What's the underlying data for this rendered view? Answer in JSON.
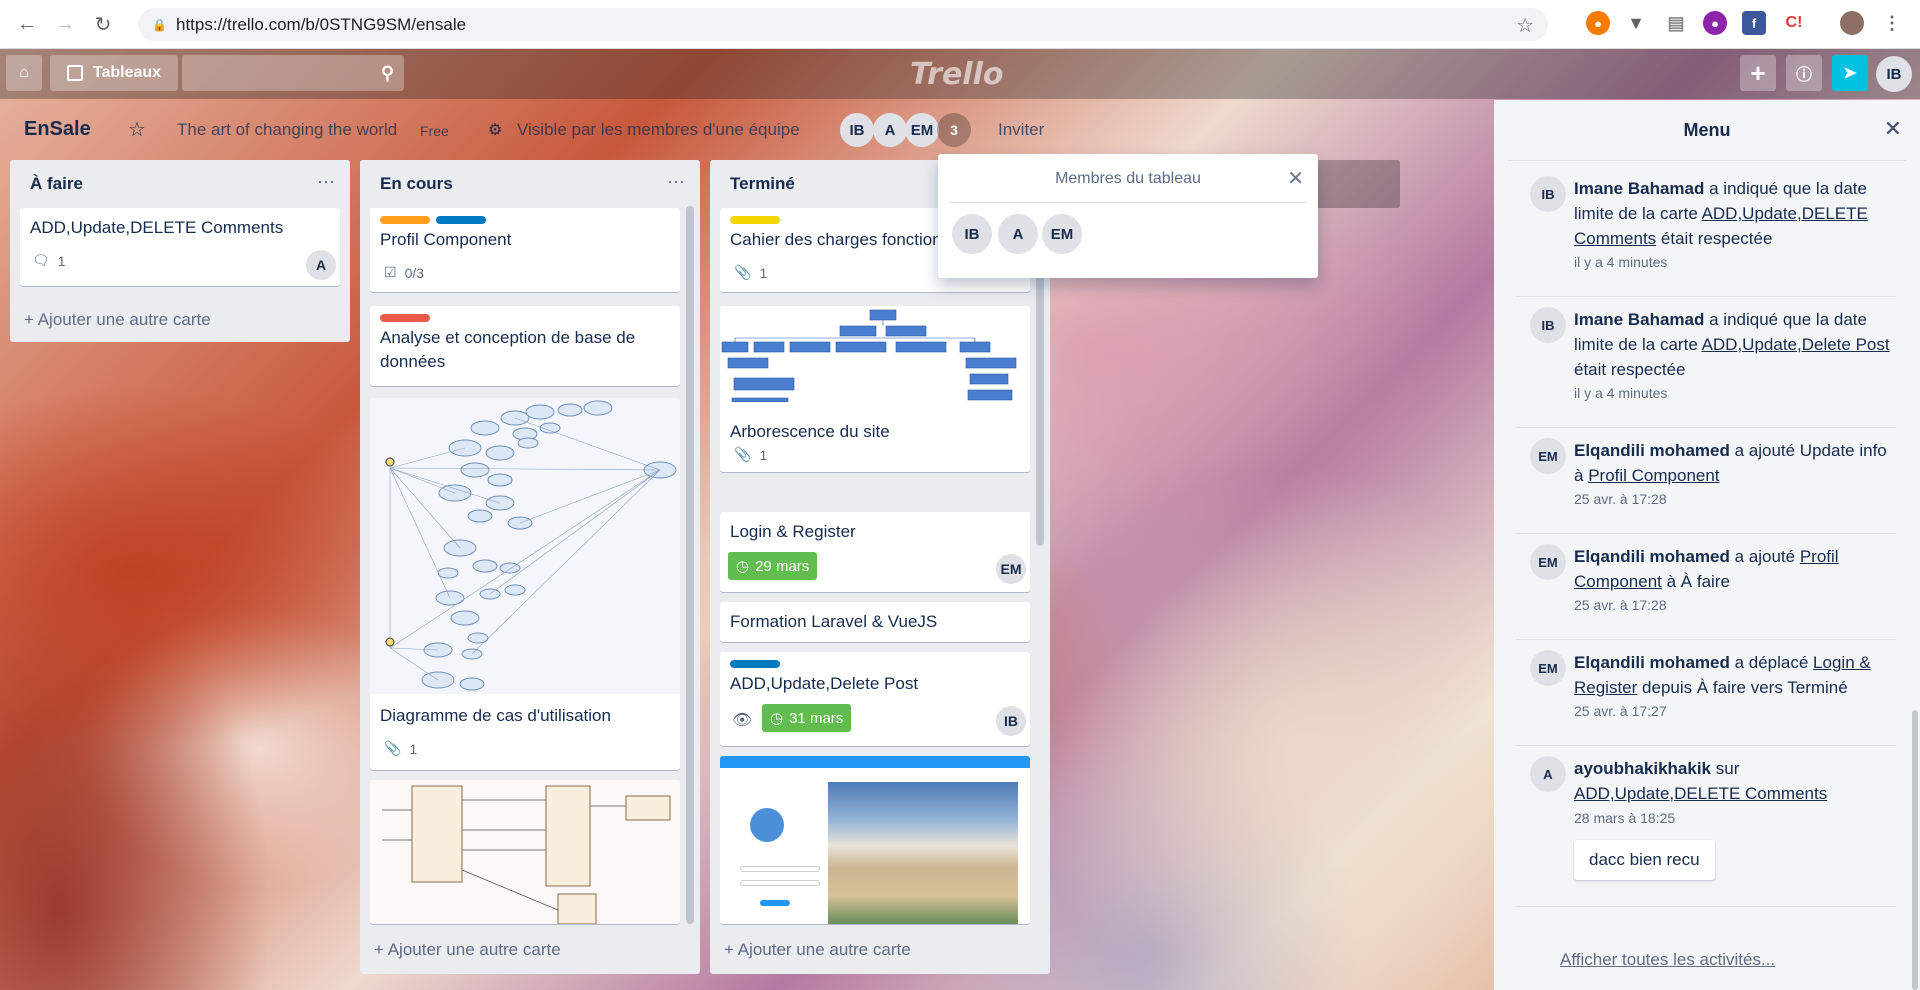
{
  "browser": {
    "url": "https://trello.com/b/0STNG9SM/ensale",
    "ext_icons": [
      "ext-orange",
      "ext-vpn",
      "ext-gray",
      "ext-purple",
      "ext-facebook",
      "ext-red",
      "ext-avatar"
    ]
  },
  "header": {
    "boards_label": "Tableaux",
    "logo": "Trello",
    "user_initials": "IB"
  },
  "board": {
    "title": "EnSale",
    "team": "The art of changing the world",
    "plan": "Free",
    "visibility": "Visible par les membres d'une équipe",
    "members": [
      "IB",
      "A",
      "EM"
    ],
    "more_count": "3",
    "invite_label": "Inviter"
  },
  "popover": {
    "title": "Membres du tableau",
    "members": [
      "IB",
      "A",
      "EM"
    ]
  },
  "lists": [
    {
      "title": "À faire",
      "add_label": "+ Ajouter une autre carte",
      "cards": [
        {
          "text": "ADD,Update,DELETE Comments",
          "comments": "1",
          "member": "A"
        }
      ]
    },
    {
      "title": "En cours",
      "add_label": "+ Ajouter une autre carte",
      "cards": [
        {
          "text": "Profil Component",
          "checklist": "0/3"
        },
        {
          "text": "Analyse et conception de base de données"
        },
        {
          "text": "Diagramme de cas d'utilisation",
          "attachments": "1"
        },
        {
          "text": ""
        }
      ]
    },
    {
      "title": "Terminé",
      "add_label": "+ Ajouter une autre carte",
      "cards": [
        {
          "text": "Cahier des charges fonctionnel",
          "attachments": "1"
        },
        {
          "text": "Arborescence du site",
          "attachments": "1"
        },
        {
          "text": "Login & Register",
          "due": "29 mars",
          "member": "EM"
        },
        {
          "text": "Formation Laravel & VueJS"
        },
        {
          "text": "ADD,Update,Delete Post",
          "due": "31 mars",
          "member": "IB"
        },
        {
          "text": ""
        }
      ]
    }
  ],
  "menu": {
    "title": "Menu",
    "activities": [
      {
        "initials": "IB",
        "user": "Imane Bahamad",
        "pre": " a indiqué que la date limite de la carte ",
        "link": "ADD,Update,DELETE Comments",
        "post": " était respectée",
        "time": "il y a 4 minutes"
      },
      {
        "initials": "IB",
        "user": "Imane Bahamad",
        "pre": " a indiqué que la date limite de la carte ",
        "link": "ADD,Update,Delete Post",
        "post": " était respectée",
        "time": "il y a 4 minutes"
      },
      {
        "initials": "EM",
        "user": "Elqandili mohamed",
        "pre": " a ajouté Update info à ",
        "link": "Profil Component",
        "post": "",
        "time": "25 avr. à 17:28"
      },
      {
        "initials": "EM",
        "user": "Elqandili mohamed",
        "pre": " a ajouté ",
        "link": "Profil Component",
        "post": " à À faire",
        "time": "25 avr. à 17:28"
      },
      {
        "initials": "EM",
        "user": "Elqandili mohamed",
        "pre": " a déplacé ",
        "link": "Login & Register",
        "post": " depuis À faire vers Terminé",
        "time": "25 avr. à 17:27"
      },
      {
        "initials": "A",
        "user": "ayoubhakikhakik",
        "pre": " sur ",
        "link": "ADD,Update,DELETE Comments",
        "post": "",
        "time": "28 mars à 18:25",
        "comment": "dacc bien recu"
      }
    ],
    "show_all": "Afficher toutes les activités..."
  },
  "colors": {
    "green_due": "#61bd4f",
    "orange_label": "#ff9f1a",
    "blue_label": "#0079bf",
    "red_label": "#eb5a46",
    "yellow_label": "#f2d600",
    "accent_cyan": "#00c2e0"
  }
}
